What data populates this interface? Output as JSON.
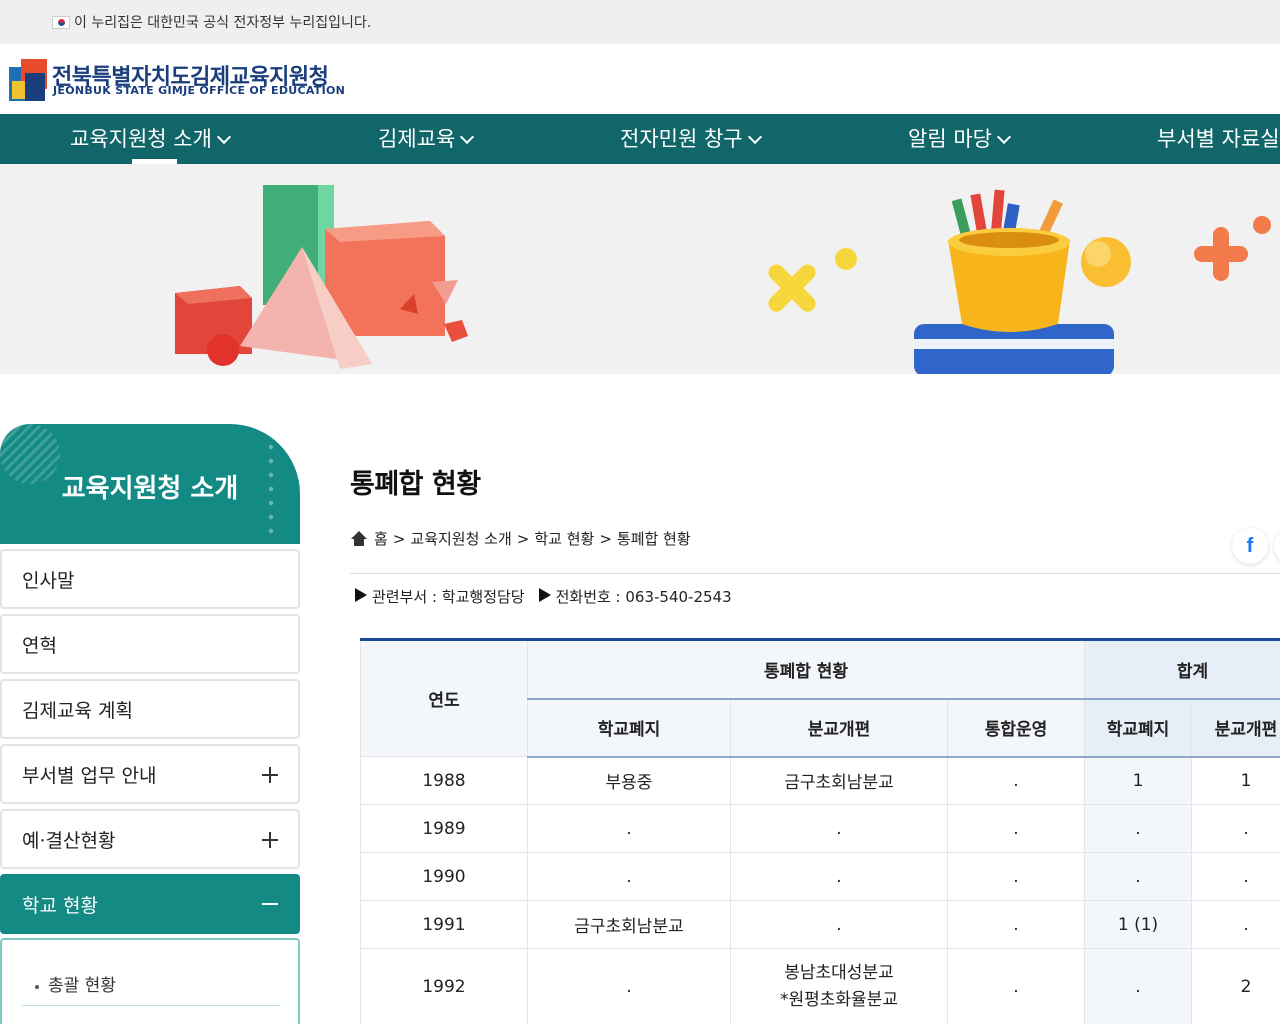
{
  "gov_notice": "이 누리집은 대한민국 공식 전자정부 누리집입니다.",
  "logo": {
    "title": "전북특별자치도김제교육지원청",
    "subtitle": "JEONBUK STATE GIMJE OFFICE OF EDUCATION"
  },
  "gnb": [
    {
      "label": "교육지원청 소개"
    },
    {
      "label": "김제교육"
    },
    {
      "label": "전자민원 창구"
    },
    {
      "label": "알림 마당"
    },
    {
      "label": "부서별 자료실"
    }
  ],
  "sidebar": {
    "title": "교육지원청 소개",
    "items": [
      {
        "label": "인사말"
      },
      {
        "label": "연혁"
      },
      {
        "label": "김제교육 계획"
      },
      {
        "label": "부서별 업무 안내"
      },
      {
        "label": "예·결산현황"
      },
      {
        "label": "학교 현황"
      }
    ],
    "sub_items": [
      {
        "label": "총괄 현황"
      }
    ]
  },
  "page": {
    "title": "통폐합 현황",
    "breadcrumb": [
      "홈",
      "교육지원청 소개",
      "학교 현황",
      "통폐합 현황"
    ],
    "breadcrumb_sep": ">",
    "facebook_glyph": "f",
    "dept_label": "관련부서 : 학교행정담당",
    "phone_label": "전화번호 : 063-540-2543"
  },
  "table": {
    "header_year": "연도",
    "header_group_status": "통폐합 현황",
    "header_group_total": "합계",
    "sub_headers": [
      "학교폐지",
      "분교개편",
      "통합운영",
      "학교폐지",
      "분교개편"
    ],
    "rows": [
      {
        "year": "1988",
        "closed": "부용중",
        "branch": "금구초회남분교",
        "merged": ".",
        "total_closed": "1",
        "total_branch": "1"
      },
      {
        "year": "1989",
        "closed": ".",
        "branch": ".",
        "merged": ".",
        "total_closed": ".",
        "total_branch": "."
      },
      {
        "year": "1990",
        "closed": ".",
        "branch": ".",
        "merged": ".",
        "total_closed": ".",
        "total_branch": "."
      },
      {
        "year": "1991",
        "closed": "금구초회남분교",
        "branch": ".",
        "merged": ".",
        "total_closed": "1 (1)",
        "total_branch": "."
      },
      {
        "year": "1992",
        "closed": ".",
        "branch_line1": "봉남초대성분교",
        "branch_line2": "*원평초화율분교",
        "merged": ".",
        "total_closed": ".",
        "total_branch": "2"
      }
    ]
  },
  "colors": {
    "nav_teal": "#11666a",
    "sidebar_teal": "#148a85",
    "logo_navy": "#1a3d7c",
    "table_top_border": "#1c4b9c"
  }
}
